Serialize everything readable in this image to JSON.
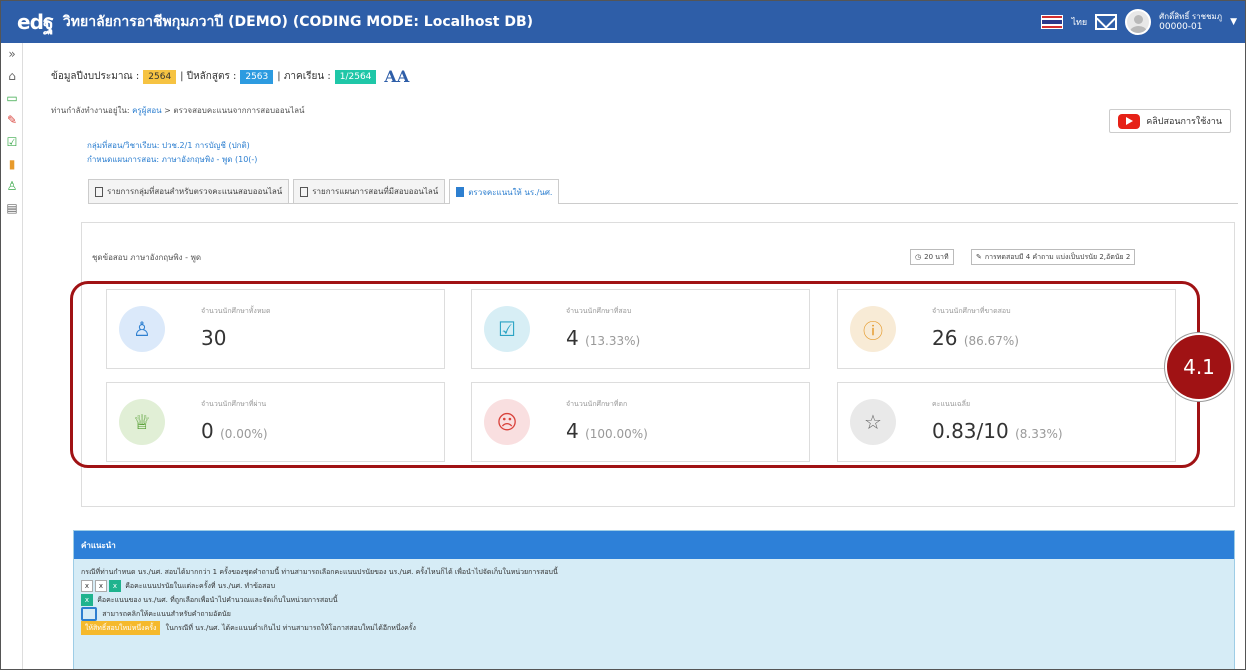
{
  "header": {
    "logo": "edฐ",
    "title": "วิทยาลัยการอาชีพกุมภวาปี (DEMO) (CODING MODE: Localhost DB)",
    "lang_label": "ไทย",
    "flag_colors": [
      "#d32f2f",
      "#ffffff",
      "#2a3a8c",
      "#ffffff",
      "#d32f2f"
    ],
    "user_name": "ศักดิ์สิทธิ์ ราชชมภู",
    "user_id": "00000-01"
  },
  "sidebar": {
    "icons": [
      {
        "name": "expand-icon",
        "glyph": "»",
        "color": "#666"
      },
      {
        "name": "home-icon",
        "glyph": "⌂",
        "color": "#666"
      },
      {
        "name": "monitor-icon",
        "glyph": "▭",
        "color": "#3aa84a"
      },
      {
        "name": "pencil-icon",
        "glyph": "✎",
        "color": "#d9433c"
      },
      {
        "name": "checkbox-icon",
        "glyph": "☑",
        "color": "#3aa84a"
      },
      {
        "name": "books-icon",
        "glyph": "▮",
        "color": "#e79a2b"
      },
      {
        "name": "user-icon",
        "glyph": "♙",
        "color": "#3aa84a"
      },
      {
        "name": "archive-icon",
        "glyph": "▤",
        "color": "#666"
      }
    ]
  },
  "info_bar": {
    "budget_label": "ข้อมูลปีงบประมาณ :",
    "budget_year": "2564",
    "curriculum_label": "| ปีหลักสูตร :",
    "curriculum_year": "2563",
    "term_label": "| ภาคเรียน :",
    "term": "1/2564",
    "font_size_control": "AA"
  },
  "breadcrumb": {
    "prefix": "ท่านกำลังทำงานอยู่ใน:",
    "link": "ครูผู้สอน",
    "current": " > ตรวจสอบคะแนนจากการสอบออนไลน์"
  },
  "video_button": "คลิปสอนการใช้งาน",
  "group_info": {
    "group_line": "กลุ่มที่สอน/วิชาเรียน: ปวช.2/1 การบัญชี (ปกติ)",
    "plan_line": "กำหนดแผนการสอน: ภาษาอังกฤษพิง - พูด (10(-)"
  },
  "tabs": [
    {
      "label": "รายการกลุ่มที่สอนสำหรับตรวจคะแนนสอบออนไลน์",
      "active": false
    },
    {
      "label": "รายการแผนการสอนที่มีสอบออนไลน์",
      "active": false
    },
    {
      "label": "ตรวจคะแนนให้ นร./นศ.",
      "active": true
    }
  ],
  "panel": {
    "exam_set": "ชุดข้อสอบ ภาษาอังกฤษพิง - พูด",
    "duration_chip": "20 นาที",
    "questions_chip": "การทดสอบมี 4 คำถาม แบ่งเป็นปรนัย 2,อัตนัย 2"
  },
  "stats": [
    {
      "label": "จำนวนนักศึกษาทั้งหมด",
      "value": "30",
      "pct": "",
      "icon": "user-icon",
      "glyph": "♙",
      "bg": "#dbe9fa",
      "fg": "#2d7fd0"
    },
    {
      "label": "จำนวนนักศึกษาที่สอบ",
      "value": "4",
      "pct": "(13.33%)",
      "icon": "checkbox-icon",
      "glyph": "☑",
      "bg": "#d7eef5",
      "fg": "#2aa3c4"
    },
    {
      "label": "จำนวนนักศึกษาที่ขาดสอบ",
      "value": "26",
      "pct": "(86.67%)",
      "icon": "info-icon",
      "glyph": "ⓘ",
      "bg": "#f8ebd6",
      "fg": "#e59a2b"
    },
    {
      "label": "จำนวนนักศึกษาที่ผ่าน",
      "value": "0",
      "pct": "(0.00%)",
      "icon": "trophy-icon",
      "glyph": "♕",
      "bg": "#e1efd6",
      "fg": "#4d9a2a"
    },
    {
      "label": "จำนวนนักศึกษาที่ตก",
      "value": "4",
      "pct": "(100.00%)",
      "icon": "sad-face-icon",
      "glyph": "☹",
      "bg": "#f9dfe0",
      "fg": "#d9433c"
    },
    {
      "label": "คะแนนเฉลี่ย",
      "value": "0.83/10",
      "pct": "(8.33%)",
      "icon": "star-icon",
      "glyph": "☆",
      "bg": "#e9e9e9",
      "fg": "#666"
    }
  ],
  "annotation": {
    "marker_label": "4.1",
    "color": "#a01214"
  },
  "advice": {
    "title": "คำแนะนำ",
    "line1": "กรณีที่ท่านกำหนด นร./นศ. สอบได้มากกว่า 1 ครั้งของชุดคำถามนี้ ท่านสามารถเลือกคะแนนปรนัยของ นร./นศ. ครั้งไหนก็ได้ เพื่อนำไปจัดเก็บในหน่วยการสอบนี้",
    "x_label": "x",
    "line2": "คือคะแนนปรนัยในแต่ละครั้งที่ นร./นศ. ทำข้อสอบ",
    "line3": "คือคะแนนของ นร./นศ. ที่ถูกเลือกเพื่อนำไปคำนวณและจัดเก็บในหน่วยการสอบนี้",
    "line4": "สามารถคลิกให้คะแนนสำหรับคำถามอัตนัย",
    "retest_label": "ให้สิทธิ์สอบใหม่หนึ่งครั้ง",
    "line5": "ในกรณีที่ นร./นศ. ได้คะแนนต่ำเกินไป ท่านสามารถให้โอกาสสอบใหม่ได้อีกหนึ่งครั้ง"
  }
}
